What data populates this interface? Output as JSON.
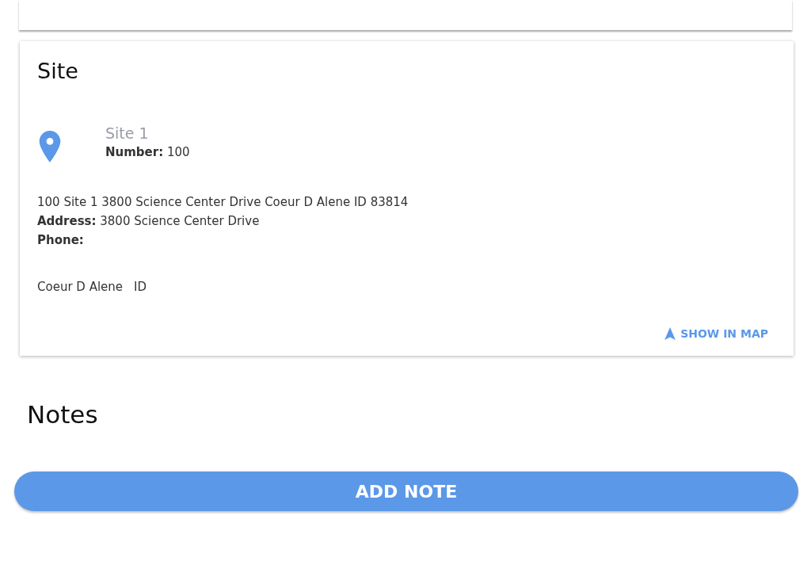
{
  "site_card": {
    "title": "Site",
    "site_name": "Site 1",
    "number": "**Number:** 100",
    "full_address": "100 Site 1 3800 Science Center Drive Coeur D Alene ID 83814",
    "address": "**Address:** 3800 Science Center Drive",
    "phone": "**Phone:**",
    "city": "Coeur D Alene",
    "state": "ID",
    "map_link": "SHOW IN MAP"
  },
  "notes": {
    "title": "Notes",
    "button": "ADD NOTE"
  }
}
